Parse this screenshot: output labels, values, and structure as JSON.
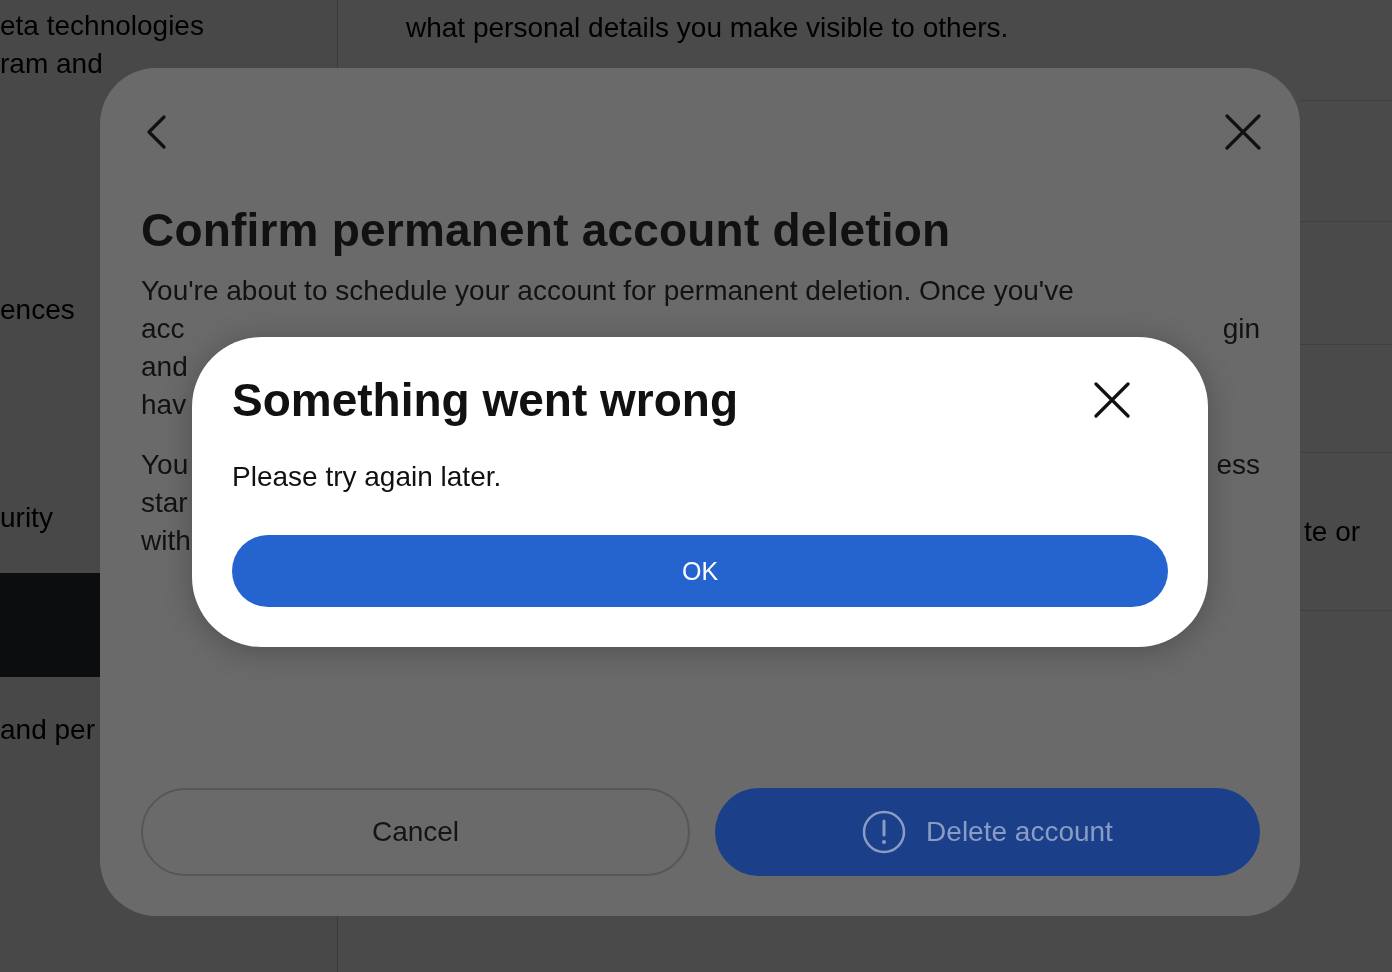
{
  "page": {
    "sidebar": {
      "items": [
        {
          "lines": [
            "eta technologies",
            "ram and"
          ],
          "selected": false
        },
        {
          "lines": [
            "ences"
          ],
          "selected": false
        },
        {
          "lines": [
            "urity"
          ],
          "selected": false
        },
        {
          "selected": true
        },
        {
          "lines": [
            "and per"
          ],
          "selected": false
        }
      ]
    },
    "main_text": "what personal details you make visible to others.",
    "right_rows": [
      {},
      {},
      {},
      {},
      {
        "text": "te or"
      },
      {}
    ]
  },
  "confirm_dialog": {
    "title": "Confirm permanent account deletion",
    "paragraphs": [
      {
        "lines": [
          {
            "left": "You're about to schedule your account for permanent deletion. Once you've"
          },
          {
            "left": "acc",
            "right": "gin"
          },
          {
            "left": "and"
          },
          {
            "left": "hav"
          }
        ]
      },
      {
        "lines": [
          {
            "left": "You",
            "right": "ess"
          },
          {
            "left": "star"
          },
          {
            "left": "with"
          }
        ]
      }
    ],
    "buttons": [
      {
        "kind": "secondary",
        "label": "Cancel"
      },
      {
        "kind": "primary",
        "label": "Delete account"
      }
    ]
  },
  "error_dialog": {
    "title": "Something went wrong",
    "message": "Please try again later.",
    "button": "OK"
  }
}
